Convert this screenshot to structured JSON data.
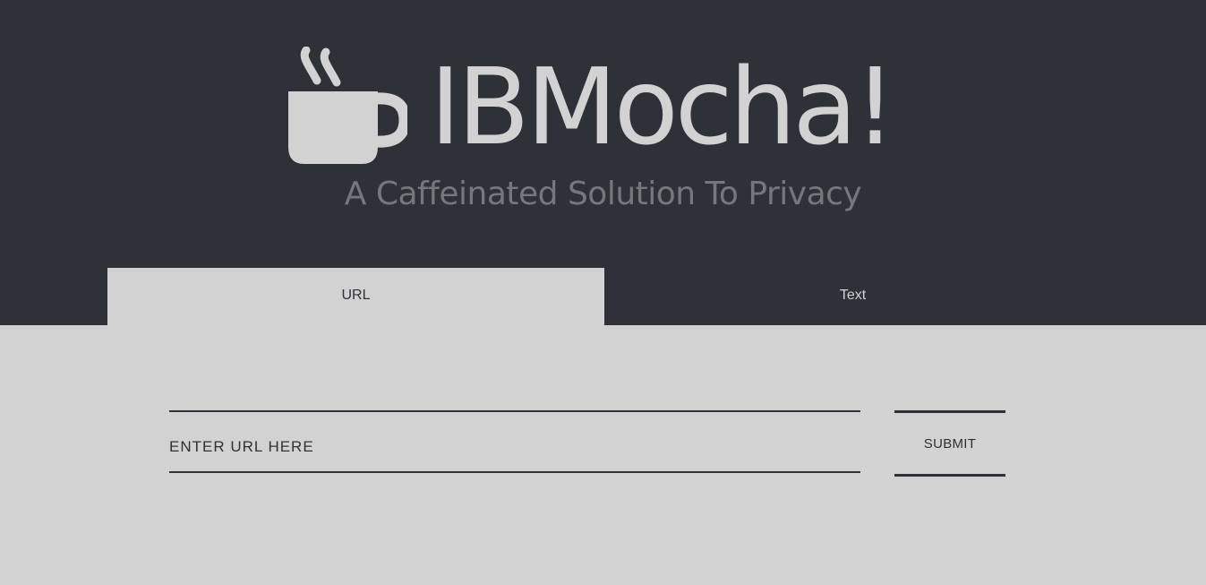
{
  "header": {
    "logo_icon": "coffee-cup-icon",
    "title": "IBMocha!",
    "tagline": "A Caffeinated Solution To Privacy",
    "background_color": "#2f3139",
    "text_color": "#d2d2d2"
  },
  "tabs": [
    {
      "label": "URL",
      "active": true
    },
    {
      "label": "Text",
      "active": false
    }
  ],
  "form": {
    "url_placeholder": "ENTER URL HERE",
    "url_value": "",
    "submit_label": "SUBMIT"
  },
  "colors": {
    "page_background": "#d2d2d2",
    "accent_dark": "#2f3139",
    "tagline": "#77777b"
  }
}
